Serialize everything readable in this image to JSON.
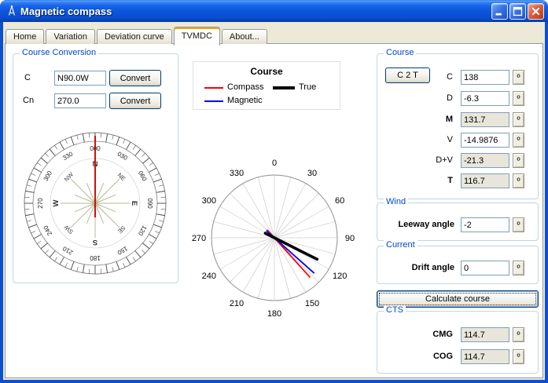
{
  "window": {
    "title": "Magnetic compass"
  },
  "tabs": {
    "active": "TVMDC",
    "items": [
      {
        "label": "Home"
      },
      {
        "label": "Variation"
      },
      {
        "label": "Deviation curve"
      },
      {
        "label": "TVMDC"
      },
      {
        "label": "About..."
      }
    ]
  },
  "units": {
    "degree": "º"
  },
  "course_conversion": {
    "title": "Course Conversion",
    "rows": [
      {
        "label": "C",
        "value": "N90.0W",
        "button_label": "Convert"
      },
      {
        "label": "Cn",
        "value": "270.0",
        "button_label": "Convert"
      }
    ]
  },
  "legend": {
    "title": "Course",
    "items": [
      {
        "label": "Compass",
        "color": "#ff0000"
      },
      {
        "label": "Magnetic",
        "color": "#0000ff"
      },
      {
        "label": "True",
        "color": "#000000"
      }
    ]
  },
  "course_panel": {
    "title": "Course",
    "c2t_button": "C 2 T",
    "rows": [
      {
        "label": "C",
        "value": "138"
      },
      {
        "label": "D",
        "value": "-6.3"
      },
      {
        "label": "M",
        "value": "131.7"
      },
      {
        "label": "V",
        "value": "-14.9876"
      },
      {
        "label": "D+V",
        "value": "-21.3"
      },
      {
        "label": "T",
        "value": "116.7"
      }
    ]
  },
  "wind_panel": {
    "title": "Wind",
    "label": "Leeway angle",
    "value": "-2"
  },
  "current_panel": {
    "title": "Current",
    "label": "Drift angle",
    "value": "0"
  },
  "calculate_button_label": "Calculate course",
  "cts_panel": {
    "title": "CTS",
    "rows": [
      {
        "label": "CMG",
        "value": "114.7"
      },
      {
        "label": "COG",
        "value": "114.7"
      }
    ]
  },
  "chart_data": [
    {
      "type": "polar",
      "name": "compass-rose",
      "degree_labels": [
        "000",
        "030",
        "060",
        "090",
        "120",
        "150",
        "180",
        "210",
        "240",
        "270",
        "300",
        "330"
      ],
      "cardinal_labels": [
        "N",
        "NE",
        "E",
        "SE",
        "S",
        "SW",
        "W",
        "NW"
      ],
      "needle_angle_deg": 0,
      "needle_color": "#cc1111",
      "rose_color": "#b7bb95"
    },
    {
      "type": "polar",
      "name": "course-lines",
      "angle_labels": [
        0,
        30,
        60,
        90,
        120,
        150,
        180,
        210,
        240,
        270,
        300,
        330
      ],
      "spoke_step_deg": 15,
      "series": [
        {
          "name": "Compass",
          "angle_deg": 138,
          "color": "#ff0000",
          "width": 1.8,
          "length": 0.84
        },
        {
          "name": "Magnetic",
          "angle_deg": 131.7,
          "color": "#0000ff",
          "width": 1.8,
          "length": 0.84
        },
        {
          "name": "True",
          "angle_deg": 116.7,
          "color": "#000000",
          "width": 3.6,
          "length": 0.76
        }
      ]
    }
  ]
}
